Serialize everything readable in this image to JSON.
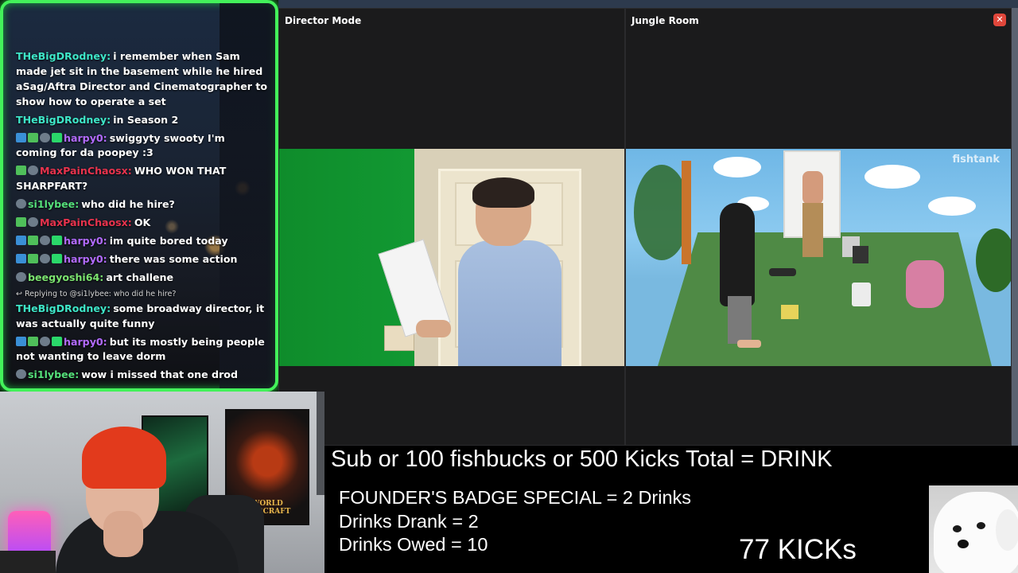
{
  "chat": {
    "messages": [
      {
        "user": "THeBigDRodney:",
        "color": "#3ee6c8",
        "badges": [],
        "text": "i remember when Sam made jet sit in the basement while he hired aSag/Aftra Director and Cinematographer to show how to operate a set"
      },
      {
        "user": "THeBigDRodney:",
        "color": "#3ee6c8",
        "badges": [],
        "text": "in Season 2"
      },
      {
        "user": "harpy0:",
        "color": "#b36bff",
        "badges": [
          "b-blue",
          "b-green",
          "b-fish",
          "b-sq"
        ],
        "text": "swiggyty swooty I'm coming for da poopey :3"
      },
      {
        "user": "MaxPainChaosx:",
        "color": "#e8334d",
        "badges": [
          "b-green",
          "b-fish"
        ],
        "text": "WHO WON THAT SHARPFART?"
      },
      {
        "user": "si1lybee:",
        "color": "#55e07a",
        "badges": [
          "b-fish"
        ],
        "text": "who did he hire?"
      },
      {
        "user": "MaxPainChaosx:",
        "color": "#e8334d",
        "badges": [
          "b-green",
          "b-fish"
        ],
        "text": "OK"
      },
      {
        "user": "harpy0:",
        "color": "#b36bff",
        "badges": [
          "b-blue",
          "b-green",
          "b-fish",
          "b-sq"
        ],
        "text": "im quite bored today"
      },
      {
        "user": "harpy0:",
        "color": "#b36bff",
        "badges": [
          "b-blue",
          "b-green",
          "b-fish",
          "b-sq"
        ],
        "text": "there was some action"
      },
      {
        "user": "beegyoshi64:",
        "color": "#7be36f",
        "badges": [
          "b-fish"
        ],
        "text": "art challene"
      },
      {
        "reply": "Replying to @si1lybee: who did he hire?"
      },
      {
        "user": "THeBigDRodney:",
        "color": "#3ee6c8",
        "badges": [],
        "text": "some broadway director, it was actually quite funny"
      },
      {
        "user": "harpy0:",
        "color": "#b36bff",
        "badges": [
          "b-blue",
          "b-green",
          "b-fish",
          "b-sq"
        ],
        "text": "but its mostly being people not wanting to leave dorm"
      },
      {
        "user": "si1lybee:",
        "color": "#55e07a",
        "badges": [
          "b-fish"
        ],
        "text": "wow i missed that one drod"
      }
    ]
  },
  "panels": {
    "director": {
      "title": "Director Mode"
    },
    "jungle": {
      "title": "Jungle Room",
      "close_label": "✕",
      "watermark": "fishtank"
    }
  },
  "webcam": {
    "poster_text": "WORLD WARCRAFT"
  },
  "overlay": {
    "drink_rule": "Sub or 100 fishbucks or 500 Kicks Total = DRINK",
    "founder_special": "FOUNDER'S BADGE SPECIAL = 2 Drinks",
    "drinks_drank": "Drinks Drank = 2",
    "drinks_owed": "Drinks Owed = 10",
    "kicks": "77 KICKs"
  },
  "colors": {
    "chat_border": "#43f25a",
    "close_button": "#e0473b"
  }
}
